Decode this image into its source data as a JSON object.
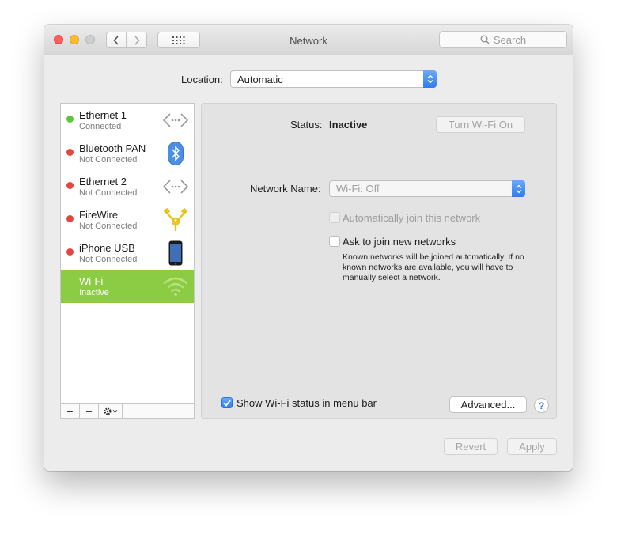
{
  "window": {
    "title": "Network"
  },
  "search": {
    "placeholder": "Search"
  },
  "location": {
    "label": "Location:",
    "value": "Automatic"
  },
  "services": [
    {
      "name": "Ethernet 1",
      "status": "Connected",
      "status_color": "#5fc63a",
      "icon": "ethernet-icon"
    },
    {
      "name": "Bluetooth PAN",
      "status": "Not Connected",
      "status_color": "#e0473f",
      "icon": "bluetooth-icon"
    },
    {
      "name": "Ethernet 2",
      "status": "Not Connected",
      "status_color": "#e0473f",
      "icon": "ethernet-icon"
    },
    {
      "name": "FireWire",
      "status": "Not Connected",
      "status_color": "#e0473f",
      "icon": "firewire-icon"
    },
    {
      "name": "iPhone USB",
      "status": "Not Connected",
      "status_color": "#e0473f",
      "icon": "iphone-icon"
    },
    {
      "name": "Wi-Fi",
      "status": "Inactive",
      "status_color": "#8ccc44",
      "icon": "wifi-icon",
      "selected": true
    }
  ],
  "sidebar_toolbar": {
    "add": "+",
    "remove": "−",
    "gear": "gear-icon"
  },
  "detail": {
    "status_label": "Status:",
    "status_value": "Inactive",
    "turn_wifi_on": "Turn Wi-Fi On",
    "network_name_label": "Network Name:",
    "network_name_value": "Wi-Fi: Off",
    "auto_join_label": "Automatically join this network",
    "ask_join_label": "Ask to join new networks",
    "ask_join_help": "Known networks will be joined automatically. If no known networks are available, you will have to manually select a network.",
    "show_status_label": "Show Wi-Fi status in menu bar",
    "show_status_checked": true,
    "advanced": "Advanced...",
    "help": "?"
  },
  "footer": {
    "revert": "Revert",
    "apply": "Apply"
  },
  "colors": {
    "accent": "#2e7cf0",
    "selection": "#8ccc44"
  }
}
